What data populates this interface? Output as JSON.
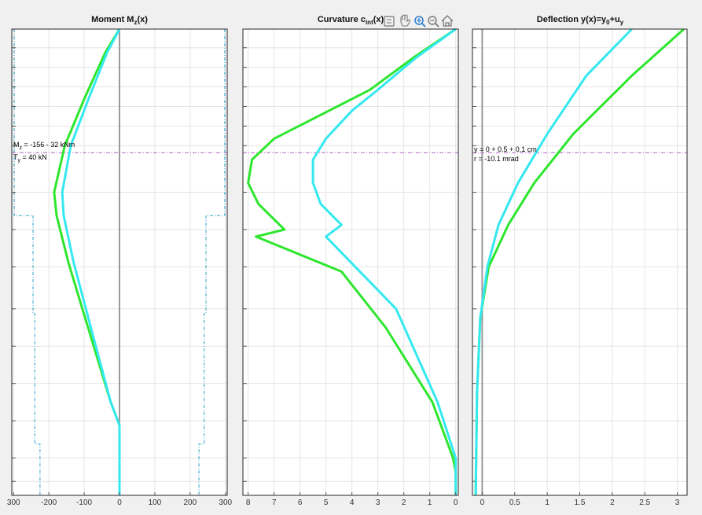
{
  "toolbar": {
    "icons": [
      "datatip-icon",
      "pan-hand-icon",
      "zoom-in-icon",
      "zoom-out-icon",
      "home-icon"
    ]
  },
  "colors": {
    "series_a": "#2ee62e",
    "series_b": "#35e8f0",
    "guide": "#b060c8",
    "limits": "#2aa0c8",
    "zero": "#9a9a9a",
    "grid": "#e4e4e4"
  },
  "chart_data": [
    {
      "type": "line",
      "title": {
        "main": "Moment M",
        "sub": "z",
        "rest": "(x)"
      },
      "xlim": [
        -305,
        305
      ],
      "xticks": [
        -300,
        -200,
        -100,
        0,
        100,
        200,
        300
      ],
      "xticklabels": [
        "300",
        "-200",
        "-100",
        "0",
        "100",
        "200",
        "300"
      ],
      "ylim": [
        0,
        1
      ],
      "grid": true,
      "zero_line": 0,
      "annotations": [
        {
          "text": "M",
          "sub": "z",
          "rest": " = -156 - 32 kNm"
        },
        {
          "text": "T",
          "sub": "y",
          "rest": " = 40 kN"
        }
      ],
      "series": [
        {
          "color": "series_a",
          "x": [
            0,
            -40,
            -100,
            -155,
            -185,
            -178,
            -145,
            -105,
            -65,
            -25,
            0,
            0,
            0
          ],
          "y": [
            0,
            0.05,
            0.15,
            0.25,
            0.35,
            0.4,
            0.5,
            0.6,
            0.7,
            0.8,
            0.85,
            0.95,
            1
          ]
        },
        {
          "color": "series_b",
          "x": [
            0,
            -35,
            -88,
            -138,
            -162,
            -158,
            -130,
            -95,
            -60,
            -25,
            0,
            0,
            0
          ],
          "y": [
            0,
            0.05,
            0.15,
            0.25,
            0.35,
            0.4,
            0.5,
            0.6,
            0.7,
            0.8,
            0.85,
            0.95,
            1
          ]
        }
      ],
      "limits": [
        {
          "x": [
            -298,
            -298,
            -245,
            -245,
            -240,
            -240,
            -225,
            -225
          ],
          "y": [
            0,
            0.4,
            0.4,
            0.61,
            0.61,
            0.89,
            0.89,
            1
          ]
        },
        {
          "x": [
            298,
            298,
            245,
            245,
            240,
            240,
            225,
            225
          ],
          "y": [
            0,
            0.4,
            0.4,
            0.61,
            0.61,
            0.89,
            0.89,
            1
          ]
        }
      ]
    },
    {
      "type": "line",
      "title": {
        "main": "Curvature c",
        "sub": "int",
        "rest": "(x)"
      },
      "xlim": [
        8.2,
        -0.1
      ],
      "xticks": [
        8,
        7,
        6,
        5,
        4,
        3,
        2,
        1,
        0
      ],
      "xticklabels": [
        "8",
        "7",
        "6",
        "5",
        "4",
        "3",
        "2",
        "1",
        "0"
      ],
      "ylim": [
        0,
        1
      ],
      "grid": true,
      "series": [
        {
          "color": "series_a",
          "x": [
            0,
            1.6,
            3.3,
            7.0,
            7.85,
            8.0,
            7.6,
            6.6,
            7.7,
            4.4,
            2.7,
            0.9,
            0.1,
            0,
            0
          ],
          "y": [
            0,
            0.06,
            0.13,
            0.235,
            0.28,
            0.33,
            0.375,
            0.43,
            0.445,
            0.52,
            0.64,
            0.8,
            0.92,
            0.95,
            1
          ]
        },
        {
          "color": "series_b",
          "x": [
            0,
            1.5,
            3.0,
            4.0,
            5.0,
            5.5,
            5.5,
            5.2,
            4.4,
            5.0,
            2.3,
            0.7,
            0,
            0,
            0
          ],
          "y": [
            0,
            0.06,
            0.13,
            0.175,
            0.235,
            0.28,
            0.33,
            0.375,
            0.42,
            0.445,
            0.6,
            0.8,
            0.92,
            0.95,
            1
          ]
        }
      ]
    },
    {
      "type": "line",
      "title": {
        "main": "Deflection y(x)=y",
        "sub": "0",
        "rest": "+u",
        "sub2": "y"
      },
      "xlim": [
        -0.15,
        3.15
      ],
      "xticks": [
        0,
        0.5,
        1,
        1.5,
        2,
        2.5,
        3
      ],
      "xticklabels": [
        "0",
        "0.5",
        "1",
        "1.5",
        "2",
        "2.5",
        "3"
      ],
      "ylim": [
        0,
        1
      ],
      "grid": true,
      "zero_line": 0,
      "annotations": [
        {
          "text": "y = 0 + 0.5 + 0.1 cm"
        },
        {
          "text": "r = -10.1 mrad"
        }
      ],
      "series": [
        {
          "color": "series_a",
          "x": [
            3.1,
            2.3,
            1.4,
            0.8,
            0.4,
            0.1,
            -0.03,
            -0.08,
            -0.1
          ],
          "y": [
            0,
            0.1,
            0.225,
            0.33,
            0.42,
            0.51,
            0.62,
            0.78,
            1
          ]
        },
        {
          "color": "series_b",
          "x": [
            2.3,
            1.6,
            1.0,
            0.55,
            0.25,
            0.08,
            -0.03,
            -0.08,
            -0.1
          ],
          "y": [
            0,
            0.1,
            0.225,
            0.33,
            0.42,
            0.51,
            0.62,
            0.78,
            1
          ]
        }
      ]
    }
  ]
}
